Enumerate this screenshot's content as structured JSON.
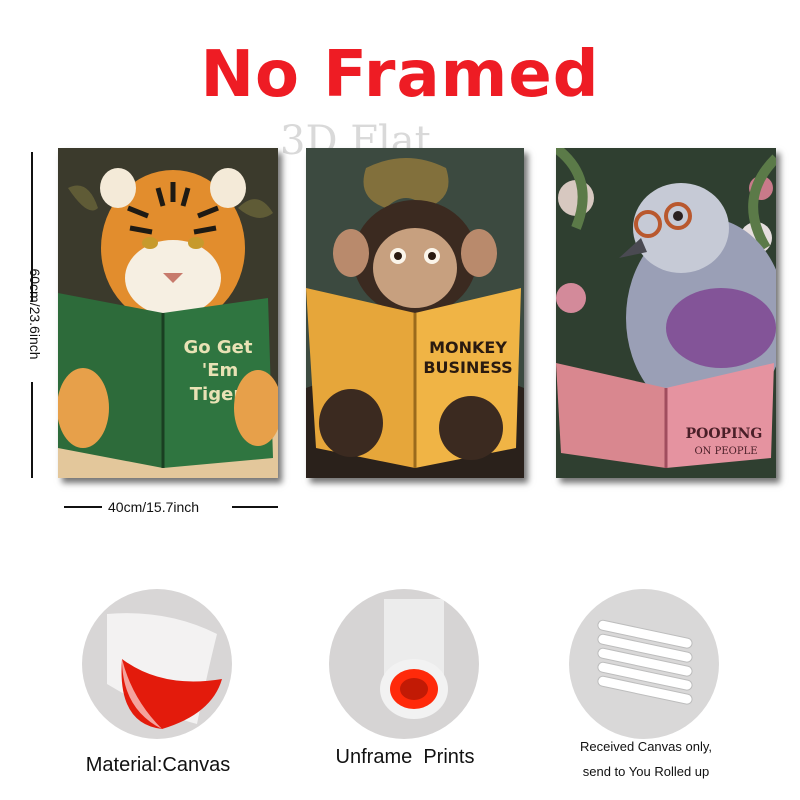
{
  "title": "No Framed",
  "watermark": "3D Flat",
  "dimensions": {
    "height_label": "60cm/23.6inch",
    "width_label": "40cm/15.7inch"
  },
  "posters": [
    {
      "book_line1": "Go Get",
      "book_line2": "'Em",
      "book_line3": "Tiger",
      "animal": "tiger-illustration"
    },
    {
      "book_line1": "MONKEY",
      "book_line2": "BUSINESS",
      "animal": "monkey-illustration"
    },
    {
      "book_line1": "POOPING",
      "book_line2": "ON PEOPLE",
      "animal": "pigeon-illustration"
    }
  ],
  "features": [
    {
      "caption": "Material:Canvas"
    },
    {
      "caption": "Unframe  Prints"
    },
    {
      "caption_line1": "Received Canvas only,",
      "caption_line2": "send to You Rolled up"
    }
  ],
  "colors": {
    "title_red": "#ee1c24",
    "canvas_red": "#e31b0c"
  }
}
